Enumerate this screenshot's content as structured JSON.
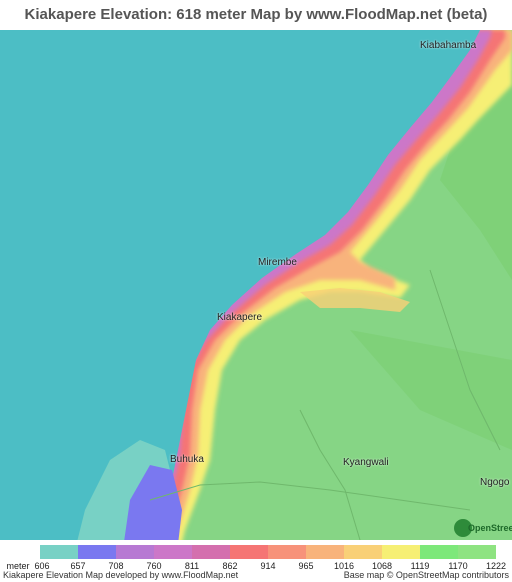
{
  "title": "Kiakapere Elevation: 618 meter Map by www.FloodMap.net (beta)",
  "places": {
    "kiabahamba": "Kiabahamba",
    "mirembe": "Mirembe",
    "kiakapere": "Kiakapere",
    "buhuka": "Buhuka",
    "kyangwali": "Kyangwali",
    "ngogo": "Ngogo"
  },
  "legend": {
    "unit": "meter",
    "labels": [
      "606",
      "657",
      "708",
      "760",
      "811",
      "862",
      "914",
      "965",
      "1016",
      "1068",
      "1119",
      "1170",
      "1222"
    ],
    "colors": [
      "#78d1c5",
      "#7a78f0",
      "#b779d3",
      "#cc77c8",
      "#d46fae",
      "#f57574",
      "#f7927a",
      "#f8b37b",
      "#f9d077",
      "#f6ef74",
      "#7de87a",
      "#8ee381"
    ]
  },
  "footer": {
    "left": "Kiakapere Elevation Map developed by www.FloodMap.net",
    "right": "Base map © OpenStreetMap contributors"
  },
  "logo": {
    "text": "OpenStreetMap"
  },
  "colors": {
    "water": "#4cbec5",
    "shallow": "#78d1c5",
    "land": "#86d585",
    "highland": "#7fcf73"
  }
}
